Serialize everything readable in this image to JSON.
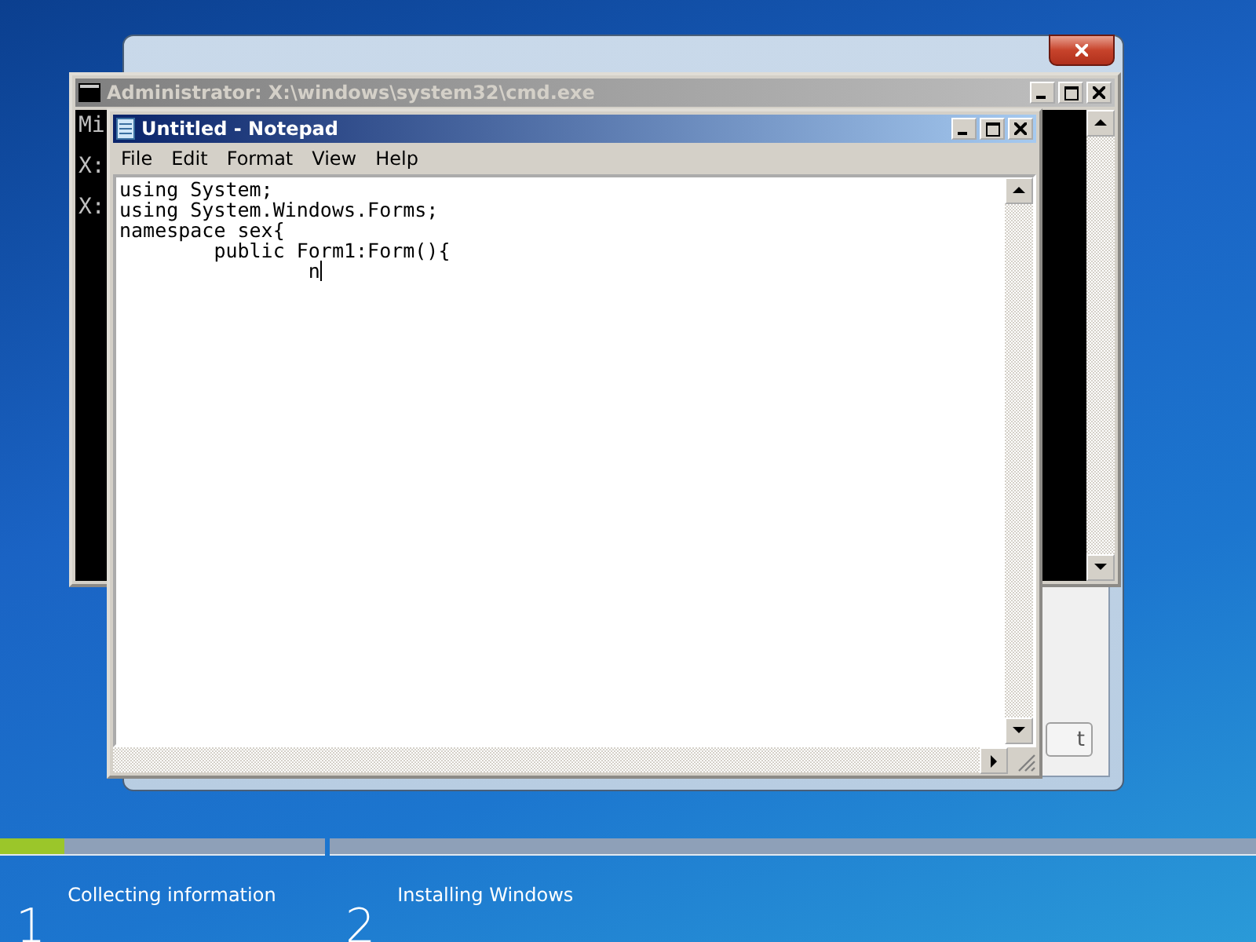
{
  "setup_window": {
    "next_button": "t"
  },
  "cmd_window": {
    "title": "Administrator: X:\\windows\\system32\\cmd.exe",
    "console_lines": [
      "Mi",
      "X:",
      "X:"
    ]
  },
  "notepad": {
    "title": "Untitled - Notepad",
    "menu": [
      "File",
      "Edit",
      "Format",
      "View",
      "Help"
    ],
    "lines": [
      "using System;",
      "using System.Windows.Forms;",
      "namespace sex{",
      "        public Form1:Form(){",
      "                n"
    ]
  },
  "progress": {
    "steps": [
      {
        "number": "1",
        "label": "Collecting information",
        "level": 0.2
      },
      {
        "number": "2",
        "label": "Installing Windows"
      }
    ]
  }
}
